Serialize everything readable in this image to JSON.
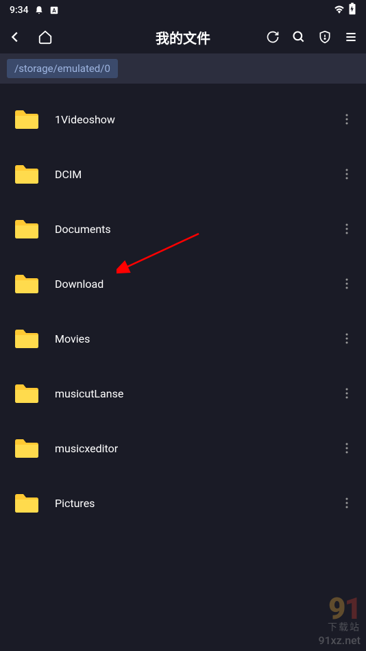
{
  "status": {
    "time": "9:34"
  },
  "toolbar": {
    "title": "我的文件"
  },
  "breadcrumb": {
    "path": "/storage/emulated/0"
  },
  "files": [
    {
      "name": "1Videoshow",
      "type": "folder"
    },
    {
      "name": "DCIM",
      "type": "folder"
    },
    {
      "name": "Documents",
      "type": "folder"
    },
    {
      "name": "Download",
      "type": "folder"
    },
    {
      "name": "Movies",
      "type": "folder"
    },
    {
      "name": "musicutLanse",
      "type": "folder"
    },
    {
      "name": "musicxeditor",
      "type": "folder"
    },
    {
      "name": "Pictures",
      "type": "folder"
    }
  ],
  "watermark": {
    "label": "下载站",
    "url": "91xz.net"
  }
}
